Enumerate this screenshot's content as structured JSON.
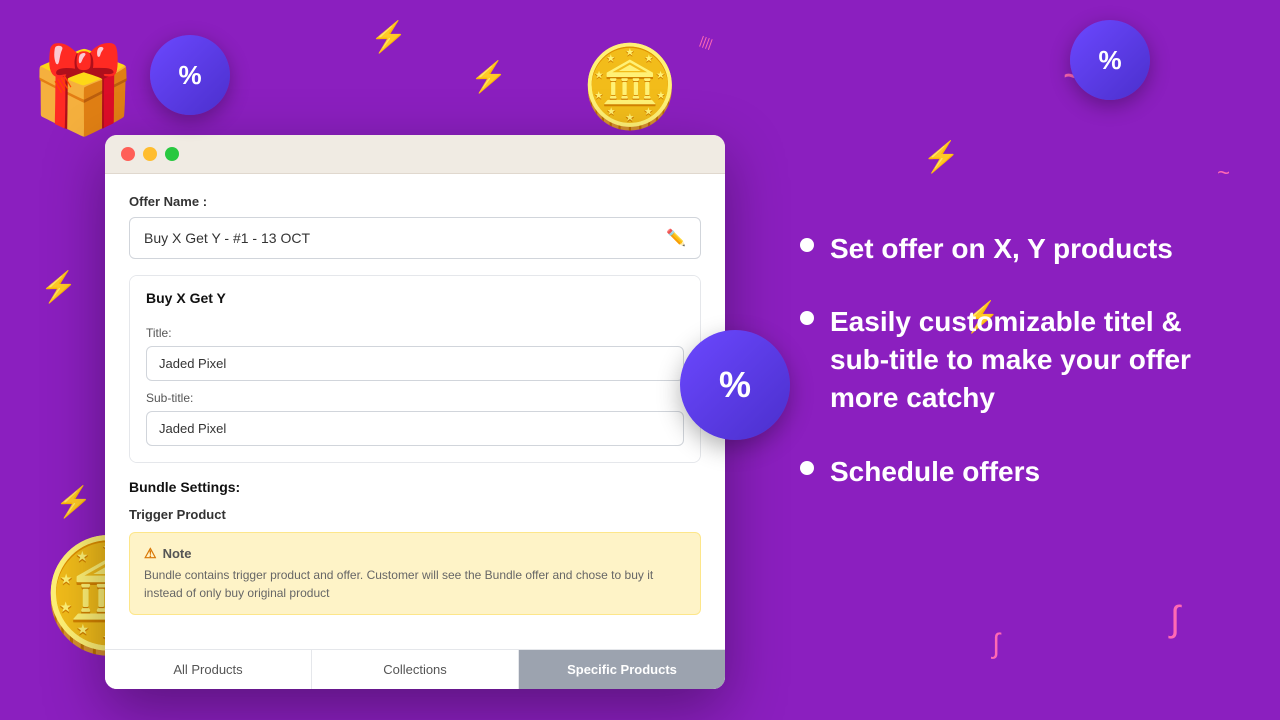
{
  "background": {
    "color": "#8B1FBF"
  },
  "browser": {
    "titlebar": {
      "traffic_lights": [
        "red",
        "yellow",
        "green"
      ]
    },
    "offer_name_section": {
      "label": "Offer Name :",
      "value": "Buy X Get Y - #1 -  13 OCT"
    },
    "buy_x_get_y": {
      "section_title": "Buy X Get Y",
      "title_label": "Title:",
      "title_value": "Jaded Pixel",
      "subtitle_label": "Sub-title:",
      "subtitle_value": "Jaded Pixel"
    },
    "bundle_settings": {
      "label": "Bundle Settings:",
      "trigger_product_label": "Trigger Product",
      "note_title": "Note",
      "note_text": "Bundle contains trigger product and offer. Customer will see the Bundle offer and  chose to buy it instead of only buy original product"
    },
    "tabs": [
      {
        "id": "all-products",
        "label": "All Products",
        "active": false
      },
      {
        "id": "collections",
        "label": "Collections",
        "active": false
      },
      {
        "id": "specific-products",
        "label": "Specific Products",
        "active": true
      }
    ]
  },
  "right_panel": {
    "features": [
      {
        "id": "feature-1",
        "text": "Set offer on X, Y products"
      },
      {
        "id": "feature-2",
        "text": "Easily customizable titel & sub-title to make your offer more catchy"
      },
      {
        "id": "feature-3",
        "text": "Schedule offers"
      }
    ]
  },
  "decorations": {
    "pct_badge_top_left": "%",
    "pct_badge_right": "%",
    "pct_badge_middle": "%"
  }
}
